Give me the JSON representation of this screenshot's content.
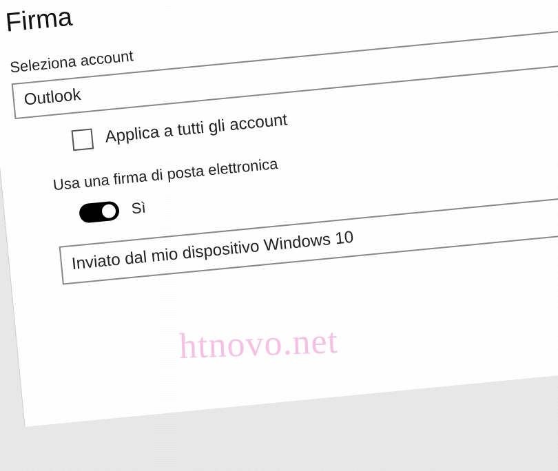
{
  "section": {
    "title": "Firma"
  },
  "account": {
    "label": "Seleziona account",
    "selected": "Outlook"
  },
  "applyAll": {
    "label": "Applica a tutti gli account",
    "checked": false
  },
  "useSignature": {
    "label": "Usa una firma di posta elettronica",
    "toggleLabel": "Sì",
    "enabled": true
  },
  "signature": {
    "text": "Inviato dal mio dispositivo Windows 10"
  },
  "watermark": "htnovo.net"
}
